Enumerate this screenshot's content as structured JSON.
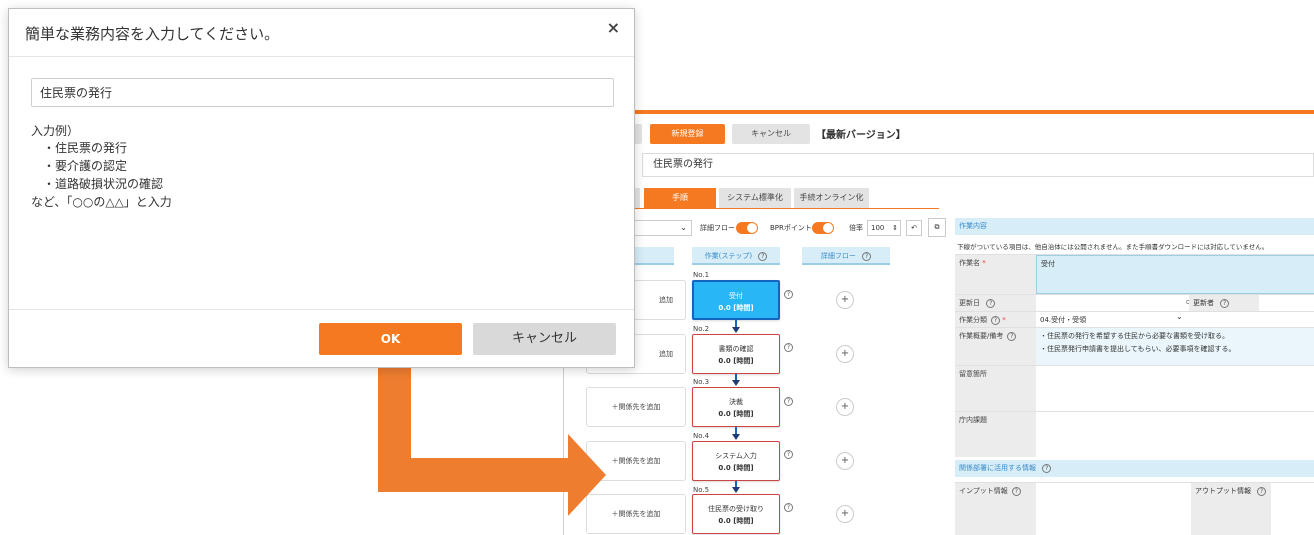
{
  "modal": {
    "title": "簡単な業務内容を入力してください。",
    "close_icon": "×",
    "input_value": "住民票の発行",
    "example_heading": "入力例）",
    "examples": [
      "・住民票の発行",
      "・要介護の認定",
      "・道路破損状況の確認"
    ],
    "example_footer": "など、「○○の△△」と入力",
    "ok_label": "OK",
    "cancel_label": "キャンセル"
  },
  "app": {
    "toolbar": {
      "register_label": "新規登録",
      "cancel_label": "キャンセル",
      "version_label": "【最新バージョン】"
    },
    "business_name": "住民票の発行",
    "tabs": [
      "手順",
      "システム標準化",
      "手続オンライン化"
    ],
    "controls": {
      "detail_flow_label": "詳細フロー",
      "bpr_point_label": "BPRポイント",
      "zoom_label": "倍率",
      "zoom_value": "100",
      "spinner_icon": "⇕",
      "undo_icon": "↶",
      "copy_icon": "⧉"
    },
    "columns": {
      "step_header": "作業(ステップ)",
      "detail_header": "詳細フロー",
      "help_icon": "?"
    },
    "steps": [
      {
        "no": "No.1",
        "name": "受付",
        "time": "0.0 [時間]"
      },
      {
        "no": "No.2",
        "name": "書類の確認",
        "time": "0.0 [時間]"
      },
      {
        "no": "No.3",
        "name": "決裁",
        "time": "0.0 [時間]"
      },
      {
        "no": "No.4",
        "name": "システム入力",
        "time": "0.0 [時間]"
      },
      {
        "no": "No.5",
        "name": "住民票の受け取り",
        "time": "0.0 [時間]"
      }
    ],
    "add_related_label": "＋関係先を追加",
    "add_related_partial": "追加",
    "plus_icon": "+",
    "detail_panel": {
      "header": "作業内容",
      "note": "下線がついている項目は、他自治体には公開されません。また手順書ダウンロードには対応していません。",
      "fields": {
        "task_name_label": "作業名",
        "task_name_value": "受付",
        "update_date_label": "更新日",
        "updater_label": "更新者",
        "category_label": "作業分類",
        "category_value": "04.受付・受領",
        "detail_label": "作業概要/備考",
        "detail_line1": "・住民票の発行を希望する住民から必要な書類を受け取る。",
        "detail_line2": "・住民票発行申請書を提出してもらい、必要事項を確認する。",
        "issue_label": "留意箇所",
        "internal_label": "庁内課題"
      },
      "related_header": "関係部署に活用する情報",
      "input_info_label": "インプット情報",
      "output_info_label": "アウトプット情報"
    }
  },
  "colors": {
    "accent": "#f47920",
    "active_step": "#29b6f6",
    "panel_header": "#d7eef8"
  }
}
